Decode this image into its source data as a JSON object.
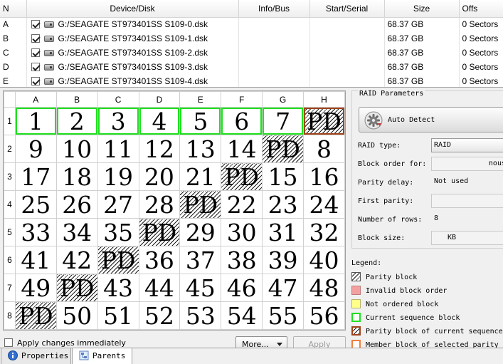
{
  "disk_table": {
    "columns": [
      "N",
      "Device/Disk",
      "Info/Bus",
      "Start/Serial",
      "Size",
      "Offs"
    ],
    "rows": [
      {
        "n": "A",
        "device": "G:/SEAGATE ST973401SS S109-0.dsk",
        "info": "",
        "start": "",
        "size": "68.37 GB",
        "offset": "0 Sectors"
      },
      {
        "n": "B",
        "device": "G:/SEAGATE ST973401SS S109-1.dsk",
        "info": "",
        "start": "",
        "size": "68.37 GB",
        "offset": "0 Sectors"
      },
      {
        "n": "C",
        "device": "G:/SEAGATE ST973401SS S109-2.dsk",
        "info": "",
        "start": "",
        "size": "68.37 GB",
        "offset": "0 Sectors"
      },
      {
        "n": "D",
        "device": "G:/SEAGATE ST973401SS S109-3.dsk",
        "info": "",
        "start": "",
        "size": "68.37 GB",
        "offset": "0 Sectors"
      },
      {
        "n": "E",
        "device": "G:/SEAGATE ST973401SS S109-4.dsk",
        "info": "",
        "start": "",
        "size": "68.37 GB",
        "offset": "0 Sectors"
      }
    ]
  },
  "grid": {
    "columns": [
      "A",
      "B",
      "C",
      "D",
      "E",
      "F",
      "G",
      "H"
    ],
    "rows": [
      {
        "label": "1",
        "cells": [
          {
            "text": "1",
            "type": "current"
          },
          {
            "text": "2",
            "type": "current"
          },
          {
            "text": "3",
            "type": "current"
          },
          {
            "text": "4",
            "type": "current"
          },
          {
            "text": "5",
            "type": "current"
          },
          {
            "text": "6",
            "type": "current"
          },
          {
            "text": "7",
            "type": "current"
          },
          {
            "text": "PD",
            "type": "parity-current"
          }
        ]
      },
      {
        "label": "2",
        "cells": [
          {
            "text": "9",
            "type": "data"
          },
          {
            "text": "10",
            "type": "data"
          },
          {
            "text": "11",
            "type": "data"
          },
          {
            "text": "12",
            "type": "data"
          },
          {
            "text": "13",
            "type": "data"
          },
          {
            "text": "14",
            "type": "data"
          },
          {
            "text": "PD",
            "type": "parity"
          },
          {
            "text": "8",
            "type": "data"
          }
        ]
      },
      {
        "label": "3",
        "cells": [
          {
            "text": "17",
            "type": "data"
          },
          {
            "text": "18",
            "type": "data"
          },
          {
            "text": "19",
            "type": "data"
          },
          {
            "text": "20",
            "type": "data"
          },
          {
            "text": "21",
            "type": "data"
          },
          {
            "text": "PD",
            "type": "parity"
          },
          {
            "text": "15",
            "type": "data"
          },
          {
            "text": "16",
            "type": "data"
          }
        ]
      },
      {
        "label": "4",
        "cells": [
          {
            "text": "25",
            "type": "data"
          },
          {
            "text": "26",
            "type": "data"
          },
          {
            "text": "27",
            "type": "data"
          },
          {
            "text": "28",
            "type": "data"
          },
          {
            "text": "PD",
            "type": "parity"
          },
          {
            "text": "22",
            "type": "data"
          },
          {
            "text": "23",
            "type": "data"
          },
          {
            "text": "24",
            "type": "data"
          }
        ]
      },
      {
        "label": "5",
        "cells": [
          {
            "text": "33",
            "type": "data"
          },
          {
            "text": "34",
            "type": "data"
          },
          {
            "text": "35",
            "type": "data"
          },
          {
            "text": "PD",
            "type": "parity"
          },
          {
            "text": "29",
            "type": "data"
          },
          {
            "text": "30",
            "type": "data"
          },
          {
            "text": "31",
            "type": "data"
          },
          {
            "text": "32",
            "type": "data"
          }
        ]
      },
      {
        "label": "6",
        "cells": [
          {
            "text": "41",
            "type": "data"
          },
          {
            "text": "42",
            "type": "data"
          },
          {
            "text": "PD",
            "type": "parity"
          },
          {
            "text": "36",
            "type": "data"
          },
          {
            "text": "37",
            "type": "data"
          },
          {
            "text": "38",
            "type": "data"
          },
          {
            "text": "39",
            "type": "data"
          },
          {
            "text": "40",
            "type": "data"
          }
        ]
      },
      {
        "label": "7",
        "cells": [
          {
            "text": "49",
            "type": "data"
          },
          {
            "text": "PD",
            "type": "parity"
          },
          {
            "text": "43",
            "type": "data"
          },
          {
            "text": "44",
            "type": "data"
          },
          {
            "text": "45",
            "type": "data"
          },
          {
            "text": "46",
            "type": "data"
          },
          {
            "text": "47",
            "type": "data"
          },
          {
            "text": "48",
            "type": "data"
          }
        ]
      },
      {
        "label": "8",
        "cells": [
          {
            "text": "PD",
            "type": "parity"
          },
          {
            "text": "50",
            "type": "data"
          },
          {
            "text": "51",
            "type": "data"
          },
          {
            "text": "52",
            "type": "data"
          },
          {
            "text": "53",
            "type": "data"
          },
          {
            "text": "54",
            "type": "data"
          },
          {
            "text": "55",
            "type": "data"
          },
          {
            "text": "56",
            "type": "data"
          }
        ]
      }
    ]
  },
  "grid_footer": {
    "apply_immediately": "Apply changes immediately",
    "more_label": "More...",
    "apply_label": "Apply"
  },
  "params": {
    "title": "RAID Parameters",
    "auto_detect": "Auto Detect",
    "raid_type_label": "RAID type:",
    "raid_type_value": "RAID",
    "block_order_label": "Block order for:",
    "block_order_value": "nous",
    "parity_delay_label": "Parity delay:",
    "parity_delay_value": "Not used",
    "first_parity_label": "First parity:",
    "first_parity_value": "",
    "rows_label": "Number of rows:",
    "rows_value": "8",
    "block_size_label": "Block size:",
    "block_size_value": "KB"
  },
  "legend": {
    "title": "Legend:",
    "items": [
      "Parity block",
      "Invalid block order",
      "Not ordered block",
      "Current sequence block",
      "Parity block of current sequence",
      "Member block of selected parity"
    ]
  },
  "tabs": [
    "Properties",
    "Parents"
  ],
  "colors": {
    "current_border": "#20e020",
    "parity_current_border": "#a0421a",
    "invalid": "#f2a0a0",
    "not_ordered": "#ffff8a",
    "member_border": "#f08040"
  },
  "icons": [
    "checkbox-checked-icon",
    "disk-icon",
    "gear-icon",
    "info-icon",
    "parents-icon",
    "chevron-down-icon"
  ]
}
